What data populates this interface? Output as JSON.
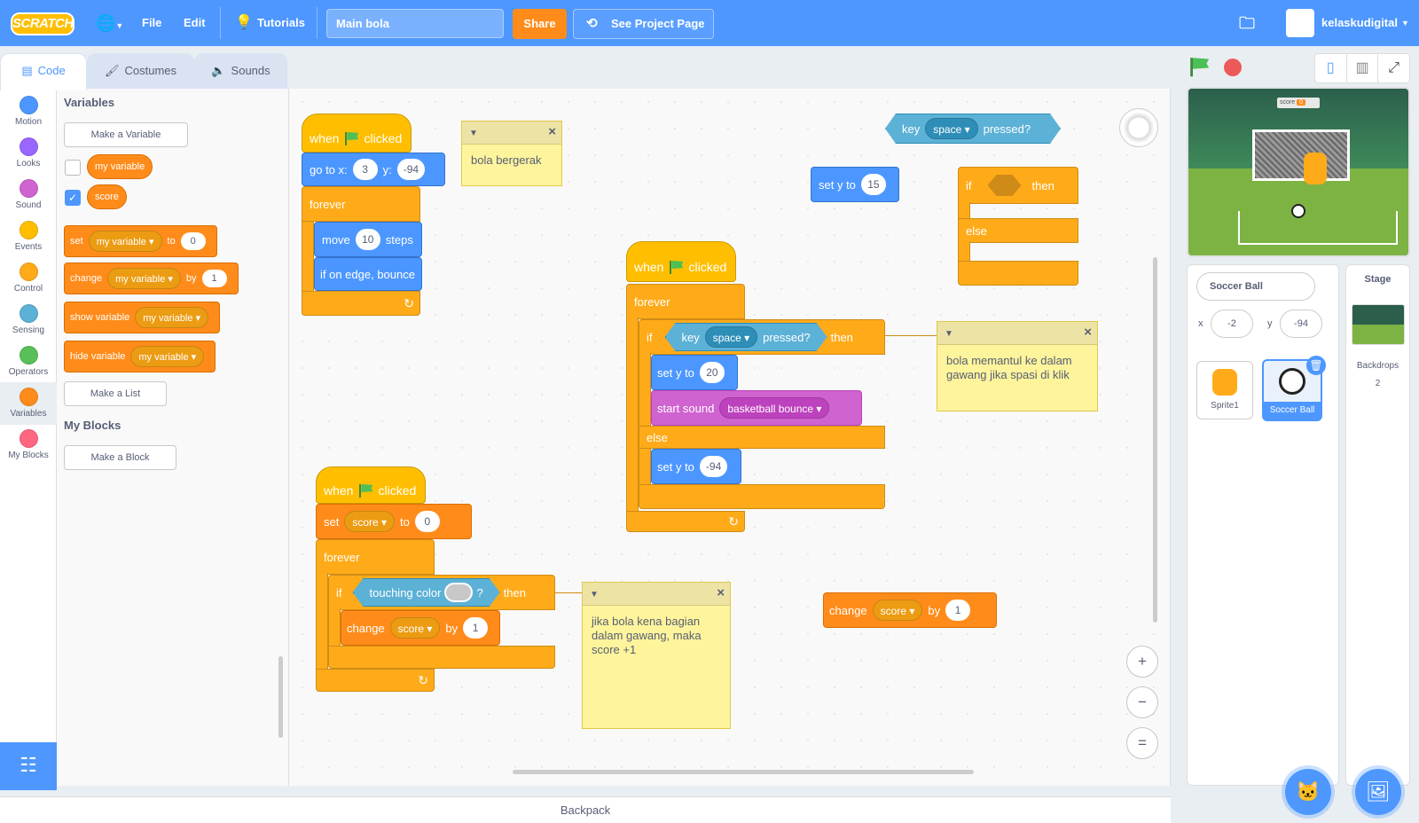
{
  "menubar": {
    "logo": "SCRATCH",
    "file": "File",
    "edit": "Edit",
    "tutorials": "Tutorials",
    "project_title": "Main bola",
    "share": "Share",
    "see_project": "See Project Page",
    "username": "kelaskudigital"
  },
  "tabs": {
    "code": "Code",
    "costumes": "Costumes",
    "sounds": "Sounds"
  },
  "categories": [
    {
      "label": "Motion",
      "color": "#4c97ff"
    },
    {
      "label": "Looks",
      "color": "#9966ff"
    },
    {
      "label": "Sound",
      "color": "#cf63cf"
    },
    {
      "label": "Events",
      "color": "#ffbf00"
    },
    {
      "label": "Control",
      "color": "#ffab19"
    },
    {
      "label": "Sensing",
      "color": "#5cb1d6"
    },
    {
      "label": "Operators",
      "color": "#59c059"
    },
    {
      "label": "Variables",
      "color": "#ff8c1a"
    },
    {
      "label": "My Blocks",
      "color": "#ff6680"
    }
  ],
  "flyout": {
    "variables_heading": "Variables",
    "make_variable": "Make a Variable",
    "var1": "my variable",
    "var2": "score",
    "set_block": {
      "set": "set",
      "var": "my variable",
      "to": "to",
      "value": "0"
    },
    "change_block": {
      "change": "change",
      "var": "my variable",
      "by": "by",
      "value": "1"
    },
    "show_block": {
      "show": "show variable",
      "var": "my variable"
    },
    "hide_block": {
      "hide": "hide variable",
      "var": "my variable"
    },
    "make_list": "Make a List",
    "myblocks_heading": "My Blocks",
    "make_block": "Make a Block"
  },
  "scripts": {
    "s1": {
      "when": "when",
      "clicked": "clicked",
      "goto": "go to x:",
      "x": "3",
      "y_label": "y:",
      "y": "-94",
      "forever": "forever",
      "move": "move",
      "steps_val": "10",
      "steps": "steps",
      "bounce": "if on edge, bounce"
    },
    "note1": "bola bergerak",
    "loose_sety": {
      "label": "set y to",
      "value": "15"
    },
    "loose_key": {
      "key": "key",
      "opt": "space",
      "pressed": "pressed?"
    },
    "loose_ifelse": {
      "if": "if",
      "then": "then",
      "else": "else"
    },
    "s2": {
      "when": "when",
      "clicked": "clicked",
      "forever": "forever",
      "if": "if",
      "key": "key",
      "opt": "space",
      "pressed": "pressed?",
      "then": "then",
      "sety1_label": "set y to",
      "sety1_val": "20",
      "sound_label": "start sound",
      "sound_val": "basketball bounce",
      "else": "else",
      "sety2_label": "set y to",
      "sety2_val": "-94"
    },
    "note2": "bola memantul ke dalam gawang jika spasi di klik",
    "s3": {
      "when": "when",
      "clicked": "clicked",
      "set": "set",
      "var": "score",
      "to": "to",
      "val": "0",
      "forever": "forever",
      "if": "if",
      "touching": "touching color",
      "q": "?",
      "then": "then",
      "change": "change",
      "cvar": "score",
      "by": "by",
      "cval": "1"
    },
    "note3": "jika bola kena bagian dalam gawang, maka score +1",
    "loose_change": {
      "change": "change",
      "var": "score",
      "by": "by",
      "val": "1"
    }
  },
  "stage_preview": {
    "score_label": "score",
    "score_value": "0"
  },
  "sprite_info": {
    "name": "Soccer Ball",
    "x_label": "x",
    "x": "-2",
    "y_label": "y",
    "y": "-94"
  },
  "sprites": [
    {
      "name": "Sprite1"
    },
    {
      "name": "Soccer Ball"
    }
  ],
  "stage_pane": {
    "title": "Stage",
    "backdrops": "Backdrops",
    "count": "2"
  },
  "backpack": "Backpack"
}
